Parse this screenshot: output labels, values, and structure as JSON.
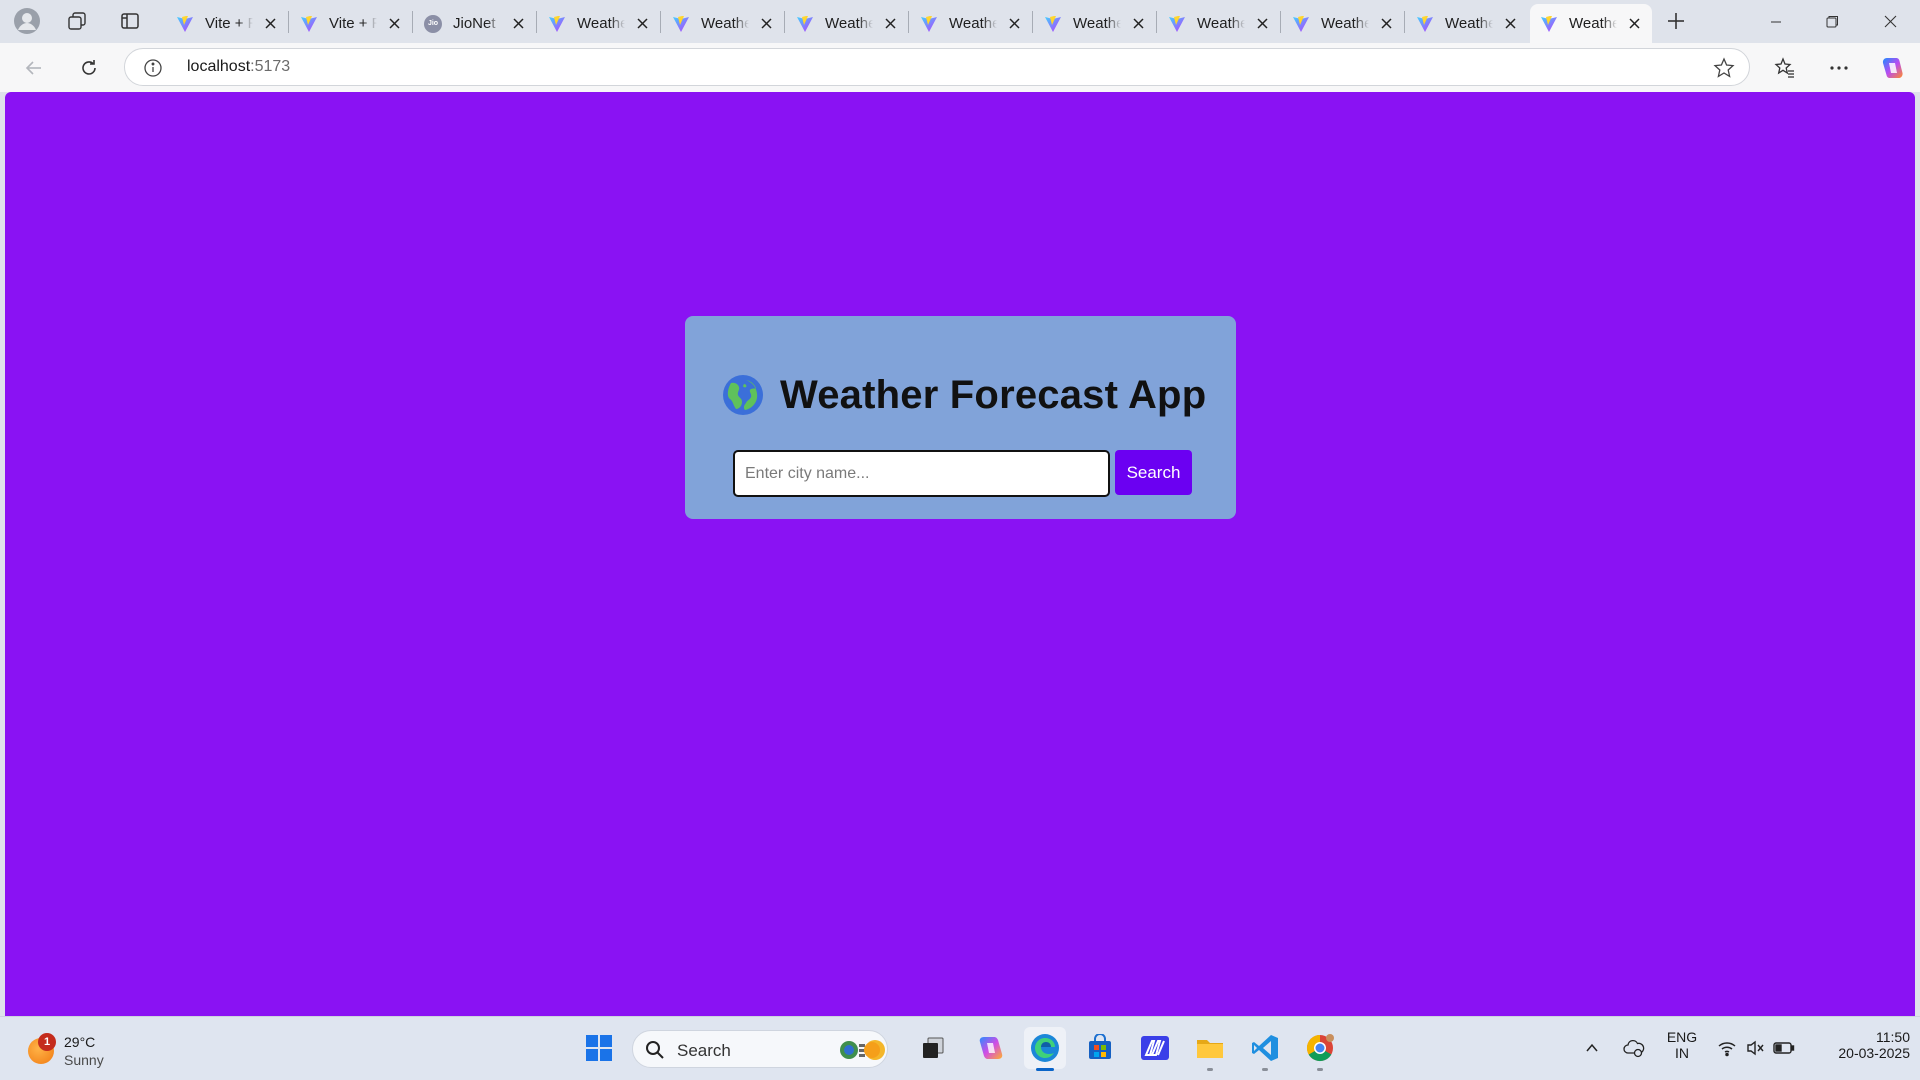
{
  "browser": {
    "tabs": [
      {
        "title": "Vite + React",
        "favicon": "vite-icon"
      },
      {
        "title": "Vite + React",
        "favicon": "vite-icon"
      },
      {
        "title": "JioNet",
        "favicon": "jio-icon"
      },
      {
        "title": "Weather",
        "favicon": "vite-icon"
      },
      {
        "title": "Weather",
        "favicon": "vite-icon"
      },
      {
        "title": "Weather",
        "favicon": "vite-icon"
      },
      {
        "title": "Weather",
        "favicon": "vite-icon"
      },
      {
        "title": "Weather",
        "favicon": "vite-icon"
      },
      {
        "title": "Weather",
        "favicon": "vite-icon"
      },
      {
        "title": "Weather",
        "favicon": "vite-icon"
      },
      {
        "title": "Weather",
        "favicon": "vite-icon"
      },
      {
        "title": "Weather",
        "favicon": "vite-icon",
        "active": true
      }
    ],
    "jio_favicon_text": "Jio",
    "address": {
      "host": "localhost",
      "port": ":5173"
    }
  },
  "page": {
    "background": "#8a12f3",
    "card_color": "#81a3d9",
    "title": "Weather Forecast App",
    "title_icon": "globe-emoji-icon",
    "search": {
      "placeholder": "Enter city name...",
      "value": "",
      "button_label": "Search"
    },
    "accent": "#6b00f2"
  },
  "taskbar": {
    "weather": {
      "badge": "1",
      "temperature": "29°C",
      "condition": "Sunny"
    },
    "search_label": "Search",
    "language": {
      "line1": "ENG",
      "line2": "IN"
    },
    "clock": {
      "time": "11:50",
      "date": "20-03-2025"
    }
  }
}
